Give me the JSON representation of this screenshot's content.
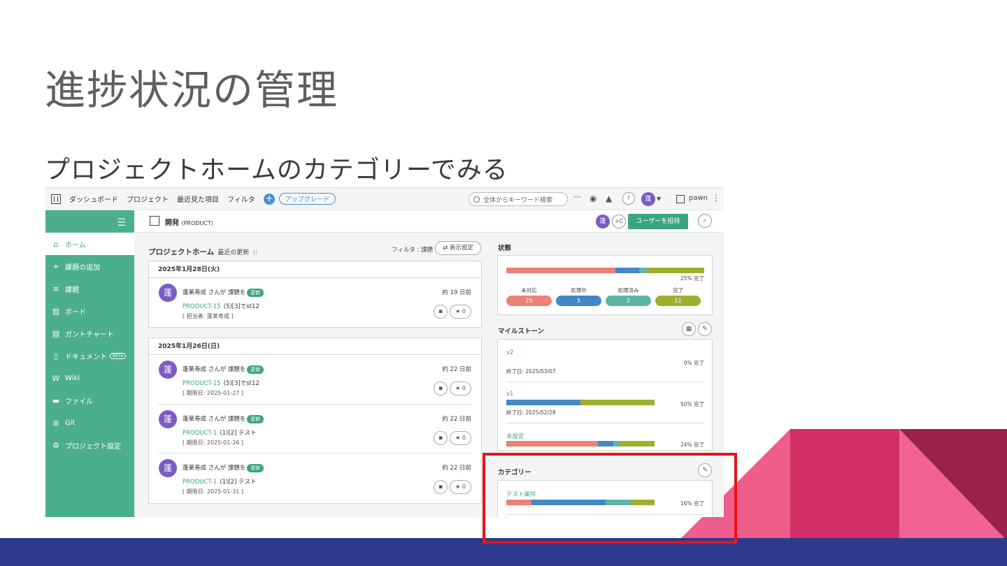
{
  "slide": {
    "title": "進捗状況の管理",
    "subtitle": "プロジェクトホームのカテゴリーでみる"
  },
  "colors": {
    "accent": "#3aa57f",
    "sidebar": "#4caf8c",
    "status_open": "#ed8077",
    "status_in_progress": "#4488c5",
    "status_resolved": "#5eb5a6",
    "status_closed": "#a1af2f",
    "highlight": "#e8141a",
    "bottom_bar": "#2d3a8c"
  },
  "topbar": {
    "nav": [
      "ダッシュボード",
      "プロジェクト",
      "最近見た項目",
      "フィルタ"
    ],
    "plus": "+",
    "upgrade": "アップグレード",
    "search_placeholder": "全体からキーワード検索",
    "more": "···",
    "help": "?",
    "avatar": "蓬",
    "space_name": "pawn"
  },
  "sidebar": {
    "items": [
      {
        "icon": "home-icon",
        "glyph": "⌂",
        "label": "ホーム"
      },
      {
        "icon": "plus-icon",
        "glyph": "+",
        "label": "課題の追加"
      },
      {
        "icon": "list-icon",
        "glyph": "≡",
        "label": "課題"
      },
      {
        "icon": "board-icon",
        "glyph": "▥",
        "label": "ボード"
      },
      {
        "icon": "gantt-icon",
        "glyph": "▤",
        "label": "ガントチャート"
      },
      {
        "icon": "document-icon",
        "glyph": "▯",
        "label": "ドキュメント"
      },
      {
        "icon": "wiki-icon",
        "glyph": "W",
        "label": "Wiki"
      },
      {
        "icon": "folder-icon",
        "glyph": "▬",
        "label": "ファイル"
      },
      {
        "icon": "git-icon",
        "glyph": "≣",
        "label": "Git"
      },
      {
        "icon": "gear-icon",
        "glyph": "⚙",
        "label": "プロジェクト設定"
      }
    ],
    "beta": "BETA"
  },
  "project": {
    "name": "開発",
    "key": "(PRODUCT)",
    "avatar": "蓬",
    "invite": "ユーザーを招待"
  },
  "home": {
    "title": "プロジェクトホーム",
    "subtitle": "最近の更新",
    "filter": "フィルタ : 課題",
    "display_settings": "表示設定",
    "days": [
      {
        "date": "2025年1月28日(火)",
        "entries": [
          {
            "avatar": "蓬",
            "who": "蓬莱寿成 さんが 課題を",
            "badge": "更新",
            "when": "約 19 日前",
            "key": "PRODUCT-15",
            "summary": "(5)[3]でst12",
            "note": "[ 担当者: 蓬莱寿成 ]",
            "stars": "0"
          }
        ]
      },
      {
        "date": "2025年1月26日(日)",
        "entries": [
          {
            "avatar": "蓬",
            "who": "蓬莱寿成 さんが 課題を",
            "badge": "更新",
            "when": "約 22 日前",
            "key": "PRODUCT-15",
            "summary": "(5)[3]でst12",
            "note": "[ 期限日: 2025-01-27 ]",
            "stars": "0"
          },
          {
            "avatar": "蓬",
            "who": "蓬莱寿成 さんが 課題を",
            "badge": "更新",
            "when": "約 22 日前",
            "key": "PRODUCT-1",
            "summary": "(1)[2] テスト",
            "note": "[ 期限日: 2025-01-26 ]",
            "stars": "0"
          },
          {
            "avatar": "蓬",
            "who": "蓬莱寿成 さんが 課題を",
            "badge": "更新",
            "when": "約 22 日前",
            "key": "PRODUCT-1",
            "summary": "(1)[2] テスト",
            "note": "[ 期限日: 2025-01-31 ]",
            "stars": "0"
          }
        ]
      }
    ]
  },
  "status_panel": {
    "title": "状態",
    "percent": "25% 完了",
    "distribution": [
      0.55,
      0.12,
      0.04,
      0.29
    ],
    "statuses": [
      {
        "label": "未対応",
        "count": "25"
      },
      {
        "label": "処理中",
        "count": "5"
      },
      {
        "label": "処理済み",
        "count": "2"
      },
      {
        "label": "完了",
        "count": "11"
      }
    ]
  },
  "milestones": {
    "title": "マイルストーン",
    "items": [
      {
        "name": "v2",
        "date": "終了日: 2025/03/07",
        "percent": "0% 完了",
        "segments": []
      },
      {
        "name": "v1",
        "date": "終了日: 2025/02/28",
        "percent": "50% 完了",
        "segments": [
          0,
          0.5,
          0,
          0.5
        ]
      },
      {
        "name": "未設定",
        "date": "",
        "percent": "24% 完了",
        "segments": [
          0.62,
          0.1,
          0.04,
          0.24
        ]
      }
    ]
  },
  "categories": {
    "title": "カテゴリー",
    "items": [
      {
        "name": "テスト案件",
        "percent": "16% 完了",
        "segments": [
          0.17,
          0.5,
          0.17,
          0.16
        ]
      }
    ]
  }
}
